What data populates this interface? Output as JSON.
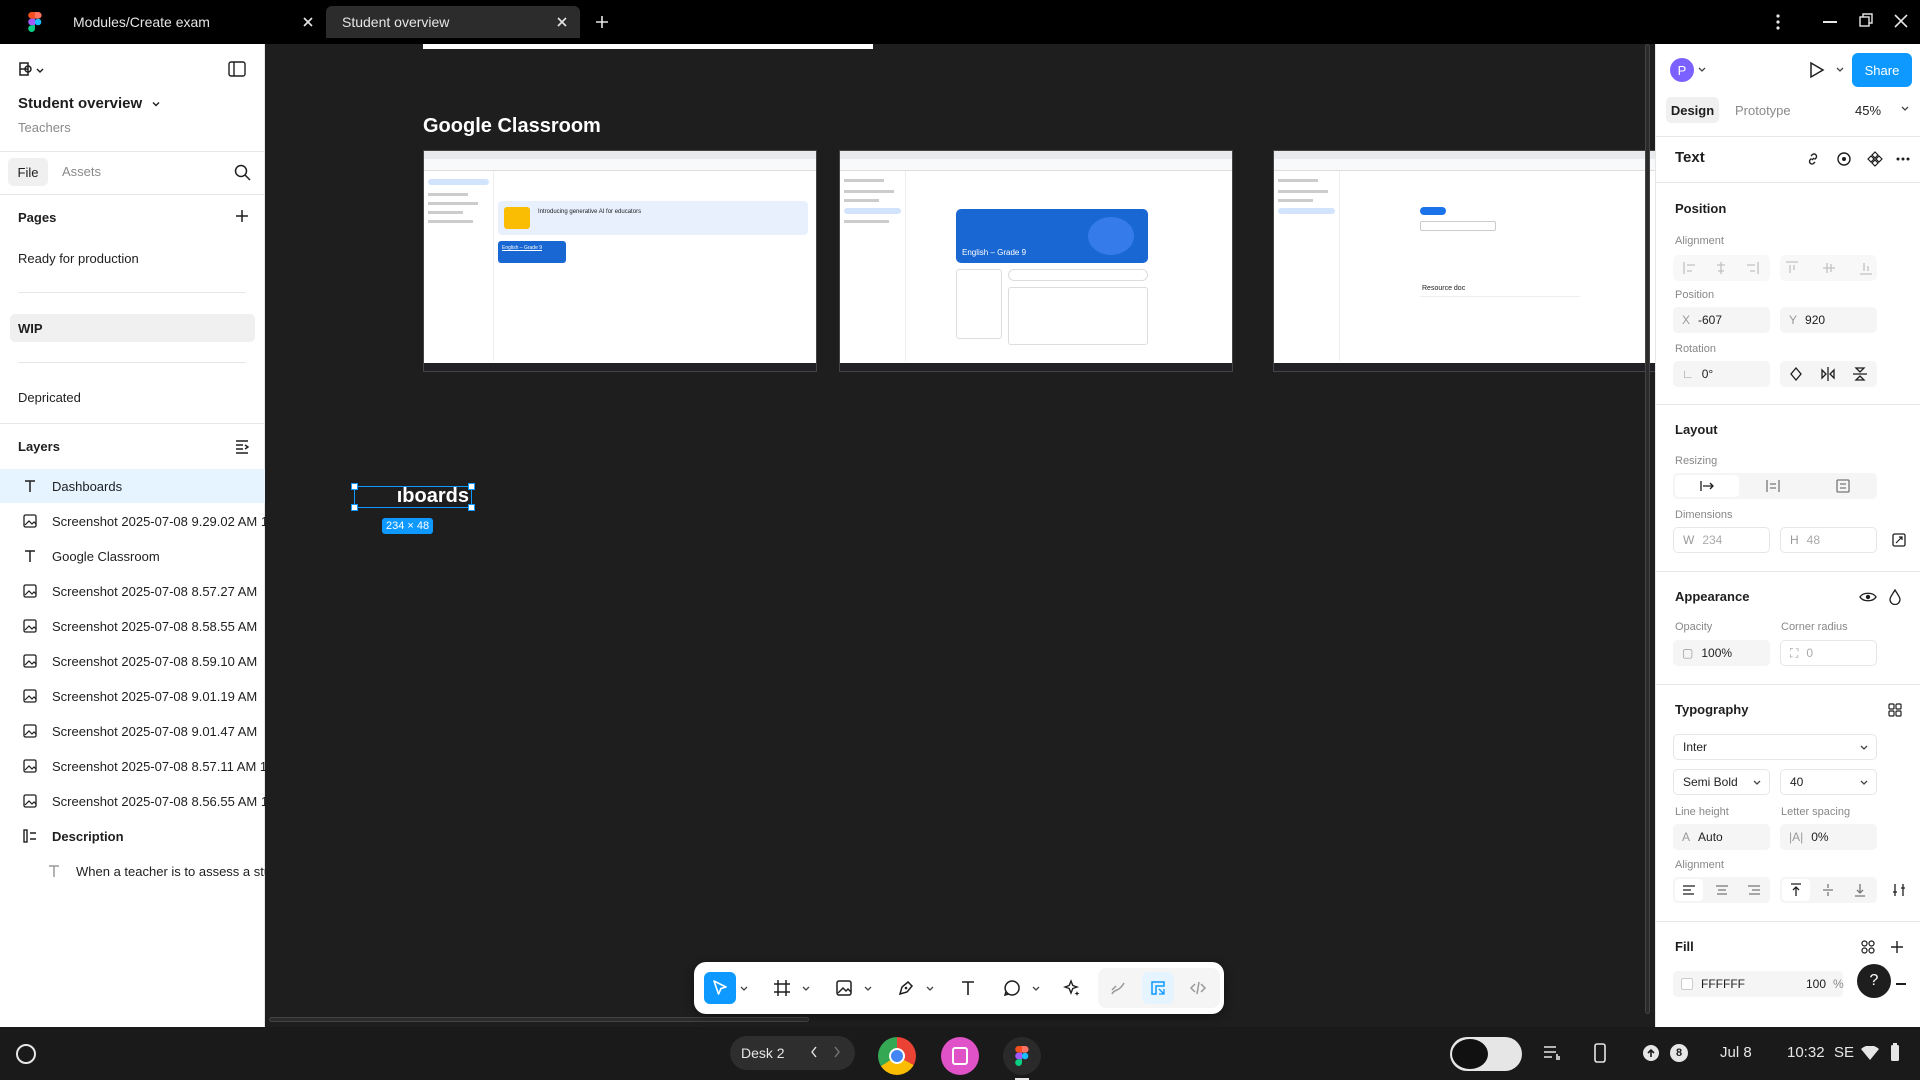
{
  "tabs": [
    {
      "label": "Modules/Create exam"
    },
    {
      "label": "Student overview"
    }
  ],
  "file": {
    "name": "Student overview",
    "project": "Teachers"
  },
  "left_tabs": {
    "file": "File",
    "assets": "Assets"
  },
  "pages": {
    "title": "Pages",
    "items": [
      "Ready for production",
      "WIP",
      "Depricated"
    ]
  },
  "layers": {
    "title": "Layers",
    "items": [
      {
        "name": "Dashboards",
        "type": "text"
      },
      {
        "name": "Screenshot 2025-07-08 9.29.02 AM 1",
        "type": "image"
      },
      {
        "name": "Google Classroom",
        "type": "text"
      },
      {
        "name": "Screenshot 2025-07-08 8.57.27 AM",
        "type": "image"
      },
      {
        "name": "Screenshot 2025-07-08 8.58.55 AM",
        "type": "image"
      },
      {
        "name": "Screenshot 2025-07-08 8.59.10 AM",
        "type": "image"
      },
      {
        "name": "Screenshot 2025-07-08 9.01.19 AM",
        "type": "image"
      },
      {
        "name": "Screenshot 2025-07-08 9.01.47 AM",
        "type": "image"
      },
      {
        "name": "Screenshot 2025-07-08 8.57.11 AM 1",
        "type": "image"
      },
      {
        "name": "Screenshot 2025-07-08 8.56.55 AM 1",
        "type": "image"
      },
      {
        "name": "Description",
        "type": "frame"
      },
      {
        "name": "When a teacher is to assess a stu",
        "type": "text"
      }
    ]
  },
  "canvas": {
    "heading": "Google Classroom",
    "editing_text": "ıboards",
    "size_badge": "234 × 48",
    "shot1": {
      "banner_title": "Introducing generative AI for educators",
      "card": "English – Grade 9"
    },
    "shot2": {
      "banner": "English – Grade 9"
    },
    "shot3": {
      "resource": "Resource doc"
    }
  },
  "right": {
    "avatar": "P",
    "share": "Share",
    "tab_design": "Design",
    "tab_prototype": "Prototype",
    "zoom": "45%",
    "section": "Text",
    "position_title": "Position",
    "alignment_label": "Alignment",
    "position_label": "Position",
    "x_key": "X",
    "x": "-607",
    "y_key": "Y",
    "y": "920",
    "rotation_label": "Rotation",
    "rotation": "0°",
    "layout_title": "Layout",
    "resizing_label": "Resizing",
    "dimensions_label": "Dimensions",
    "w_key": "W",
    "w": "234",
    "h_key": "H",
    "h": "48",
    "appearance_title": "Appearance",
    "opacity_label": "Opacity",
    "opacity": "100%",
    "corner_label": "Corner radius",
    "corner": "0",
    "typography_title": "Typography",
    "font": "Inter",
    "weight": "Semi Bold",
    "size": "40",
    "lineheight_label": "Line height",
    "lineheight": "Auto",
    "letterspacing_label": "Letter spacing",
    "letterspacing": "0%",
    "talign_label": "Alignment",
    "fill_title": "Fill",
    "fill_hex": "FFFFFF",
    "fill_opacity": "100",
    "fill_pct": "%",
    "help": "?"
  },
  "shelf": {
    "desk": "Desk 2",
    "date": "Jul 8",
    "time": "10:32",
    "region": "SE",
    "badge": "8"
  },
  "colors": {
    "accent": "#0d99ff",
    "canvas": "#1e1e1e"
  }
}
